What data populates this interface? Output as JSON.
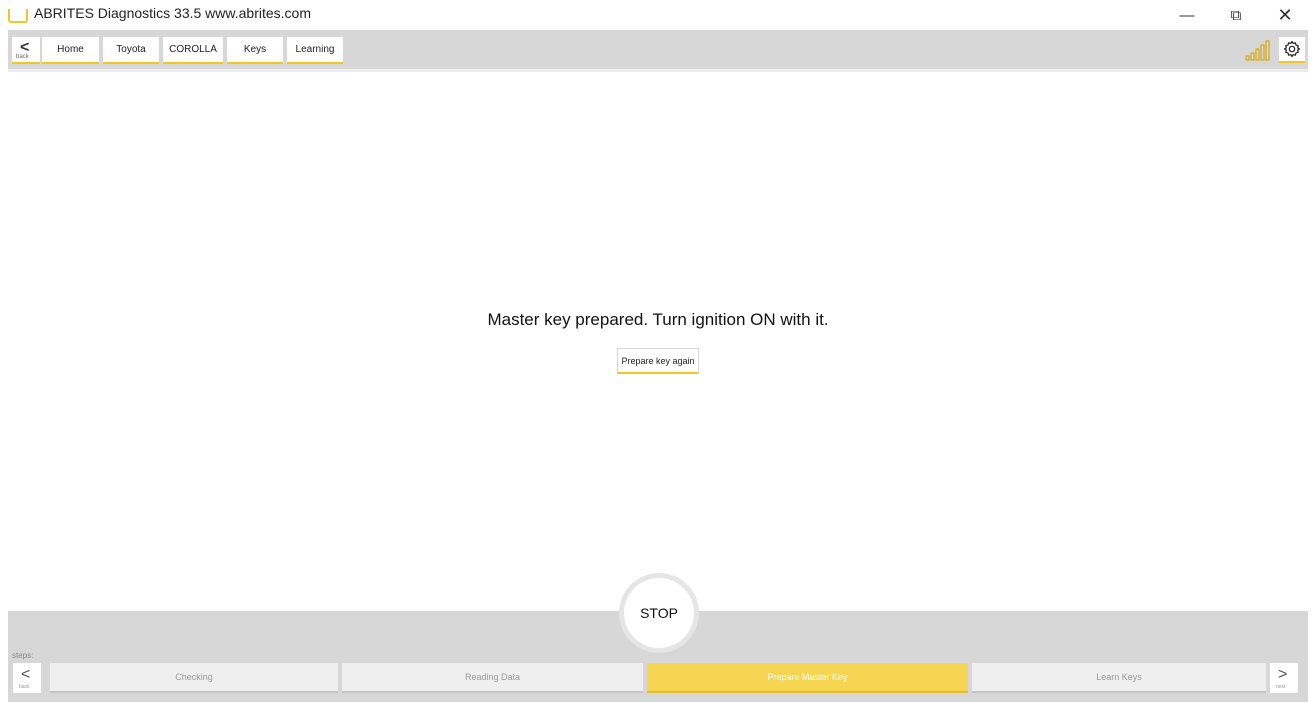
{
  "window": {
    "title": "ABRITES Diagnostics 33.5   www.abrites.com",
    "minimize_glyph": "—",
    "restore_glyph": "⧉",
    "close_glyph": "✕"
  },
  "nav": {
    "back_glyph": "<",
    "back_label": "back",
    "breadcrumbs": [
      "Home",
      "Toyota",
      "COROLLA",
      "Keys",
      "Learning"
    ],
    "signal_icon": "signal-bars-icon",
    "settings_icon": "gear-icon"
  },
  "main": {
    "message": "Master key prepared. Turn ignition ON with it.",
    "prepare_button": "Prepare key again"
  },
  "footer": {
    "stop_label": "STOP",
    "steps_label": "steps:",
    "back_glyph": "<",
    "back_label": "back",
    "next_glyph": ">",
    "next_label": "next",
    "steps": [
      "Checking",
      "Reading Data",
      "Prepare Master Key",
      "Learn Keys"
    ],
    "active_step": "Prepare Master Key"
  },
  "colors": {
    "accent": "#f3c623",
    "active_step": "#f6d552",
    "bar_gray": "#d7d7d7"
  }
}
